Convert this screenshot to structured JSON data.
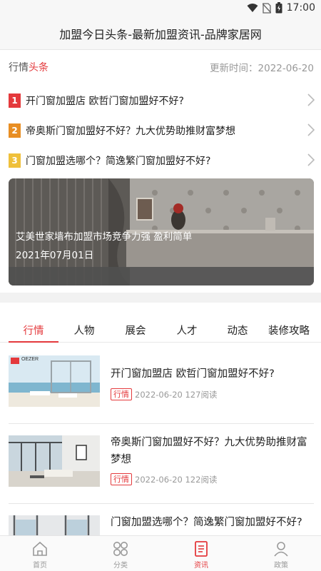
{
  "status": {
    "time": "17:00"
  },
  "header": {
    "title": "加盟今日头条-最新加盟资讯-品牌家居网"
  },
  "hot": {
    "label_prefix": "行情",
    "label_accent": "头条",
    "updated": "更新时间：2022-06-20",
    "items": [
      {
        "rank": "1",
        "title": "开门窗加盟店 欧哲门窗加盟好不好?"
      },
      {
        "rank": "2",
        "title": "帝奥斯门窗加盟好不好？九大优势助推财富梦想"
      },
      {
        "rank": "3",
        "title": "门窗加盟选哪个？简逸繁门窗加盟好不好?"
      }
    ],
    "banner": {
      "title": "艾美世家墙布加盟市场竞争力强 盈利简单",
      "date": "2021年07月01日"
    }
  },
  "tabs": [
    "行情",
    "人物",
    "展会",
    "人才",
    "动态",
    "装修攻略"
  ],
  "articles": [
    {
      "title": "开门窗加盟店 欧哲门窗加盟好不好?",
      "tag": "行情",
      "meta": "2022-06-20 127阅读",
      "thumb_brand": "OEZER"
    },
    {
      "title": "帝奥斯门窗加盟好不好？九大优势助推财富梦想",
      "tag": "行情",
      "meta": "2022-06-20 122阅读"
    },
    {
      "title": "门窗加盟选哪个？简逸繁门窗加盟好不好?"
    }
  ],
  "tabbar": [
    {
      "label": "首页",
      "icon": "home-icon"
    },
    {
      "label": "分类",
      "icon": "category-icon"
    },
    {
      "label": "资讯",
      "icon": "news-icon"
    },
    {
      "label": "政策",
      "icon": "profile-icon"
    }
  ],
  "colors": {
    "accent": "#e4393c",
    "rank2": "#e88e23",
    "rank3": "#efc03a"
  }
}
